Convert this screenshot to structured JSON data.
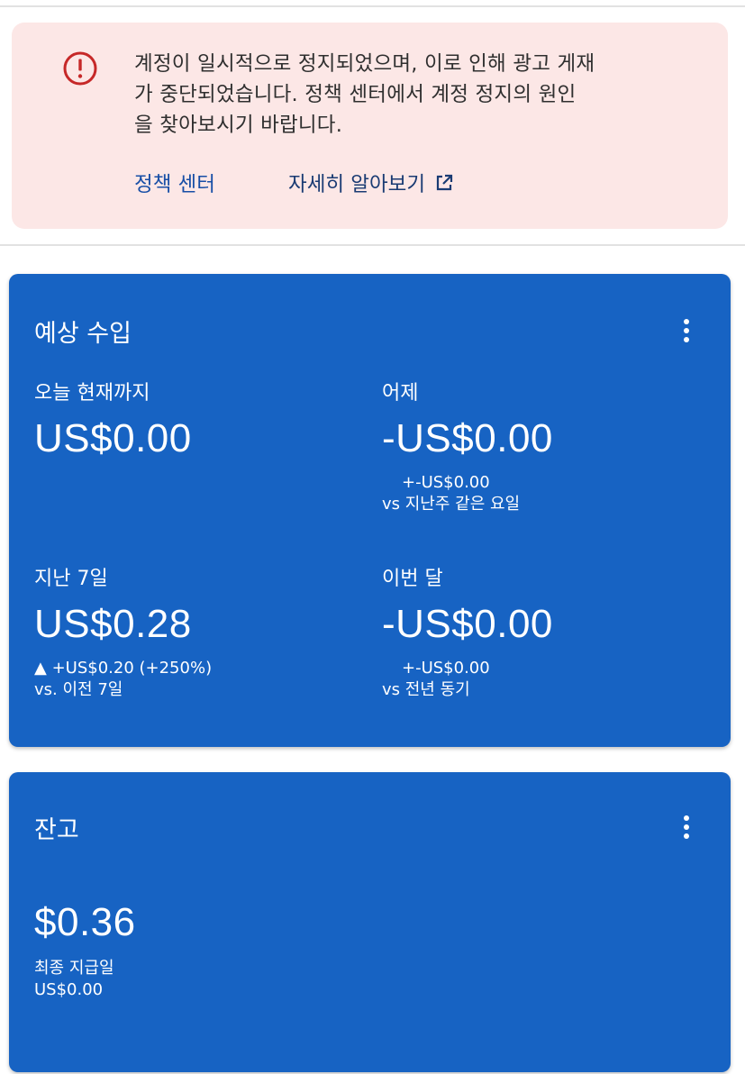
{
  "alert": {
    "icon": "error-circle-icon",
    "color": "#c62828",
    "lines": [
      "계정이 일시적으로 정지되었으며, 이로 인해 광고 게재",
      "가 중단되었습니다. 정책 센터에서 계정 정지의 원인",
      "을 찾아보시기 바랍니다."
    ],
    "policy_link": "정책 센터",
    "learn_more_link": "자세히 알아보기"
  },
  "earnings": {
    "title": "예상 수입",
    "today": {
      "label": "오늘 현재까지",
      "value": "US$0.00"
    },
    "yesterday": {
      "label": "어제",
      "value": "-US$0.00",
      "delta": "+-US$0.00",
      "compare": "vs 지난주 같은 요일"
    },
    "last7": {
      "label": "지난 7일",
      "value": "US$0.28",
      "delta": "▲ +US$0.20 (+250%)",
      "compare": "vs. 이전 7일"
    },
    "this_month": {
      "label": "이번 달",
      "value": "-US$0.00",
      "delta": "+-US$0.00",
      "compare": "vs 전년 동기"
    }
  },
  "balance": {
    "title": "잔고",
    "value": "$0.36",
    "last_payment_label": "최종 지급일",
    "last_payment_value": "US$0.00"
  },
  "colors": {
    "card_bg": "#1763c3",
    "alert_bg": "#fce7e6",
    "link": "#174ea6"
  }
}
